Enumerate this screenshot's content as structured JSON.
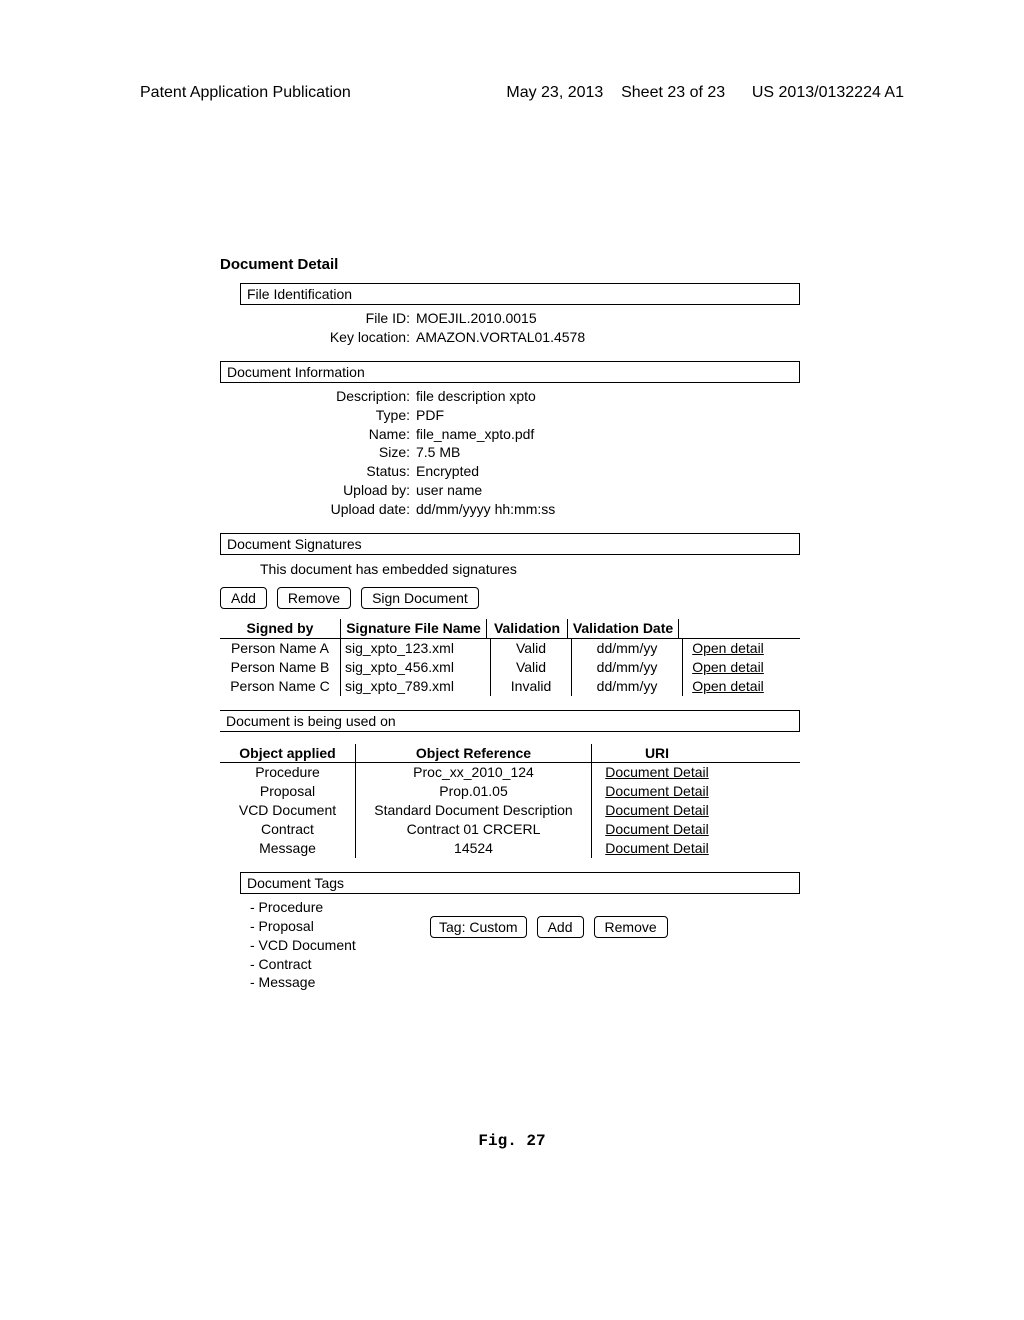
{
  "header": {
    "left": "Patent Application Publication",
    "date": "May 23, 2013",
    "sheet": "Sheet 23 of 23",
    "pubnum": "US 2013/0132224 A1"
  },
  "title": "Document Detail",
  "file_id_section": {
    "header": "File Identification",
    "fields": {
      "file_id_label": "File ID:",
      "file_id_value": "MOEJIL.2010.0015",
      "key_loc_label": "Key location:",
      "key_loc_value": "AMAZON.VORTAL01.4578"
    }
  },
  "doc_info_section": {
    "header": "Document Information",
    "fields": {
      "desc_label": "Description:",
      "desc_value": "file description xpto",
      "type_label": "Type:",
      "type_value": "PDF",
      "name_label": "Name:",
      "name_value": "file_name_xpto.pdf",
      "size_label": "Size:",
      "size_value": "7.5 MB",
      "status_label": "Status:",
      "status_value": "Encrypted",
      "upby_label": "Upload by:",
      "upby_value": "user name",
      "update_label": "Upload date:",
      "update_value": "dd/mm/yyyy hh:mm:ss"
    }
  },
  "signatures_section": {
    "header": "Document Signatures",
    "msg": "This document has embedded signatures",
    "buttons": {
      "add": "Add",
      "remove": "Remove",
      "sign": "Sign Document"
    },
    "columns": {
      "c1": "Signed by",
      "c2": "Signature File Name",
      "c3": "Validation",
      "c4": "Validation Date",
      "c5": ""
    },
    "rows": [
      {
        "signed": "Person Name A",
        "file": "sig_xpto_123.xml",
        "valid": "Valid",
        "date": "dd/mm/yy",
        "link": "Open detail"
      },
      {
        "signed": "Person Name B",
        "file": "sig_xpto_456.xml",
        "valid": "Valid",
        "date": "dd/mm/yy",
        "link": "Open detail"
      },
      {
        "signed": "Person Name C",
        "file": "sig_xpto_789.xml",
        "valid": "Invalid",
        "date": "dd/mm/yy",
        "link": "Open detail"
      }
    ]
  },
  "used_on_section": {
    "header": "Document is being used on",
    "columns": {
      "u1": "Object applied",
      "u2": "Object Reference",
      "u3": "URI"
    },
    "rows": [
      {
        "obj": "Procedure",
        "ref": "Proc_xx_2010_124",
        "uri": "Document Detail"
      },
      {
        "obj": "Proposal",
        "ref": "Prop.01.05",
        "uri": "Document Detail"
      },
      {
        "obj": "VCD Document",
        "ref": "Standard Document Description",
        "uri": "Document Detail"
      },
      {
        "obj": "Contract",
        "ref": "Contract 01 CRCERL",
        "uri": "Document Detail"
      },
      {
        "obj": "Message",
        "ref": "14524",
        "uri": "Document Detail"
      }
    ]
  },
  "tags_section": {
    "header": "Document Tags",
    "tags": [
      "- Procedure",
      "- Proposal",
      "- VCD Document",
      "- Contract",
      "- Message"
    ],
    "tag_input_value": "Tag: Custom",
    "add": "Add",
    "remove": "Remove"
  },
  "figure_caption": "Fig. 27"
}
